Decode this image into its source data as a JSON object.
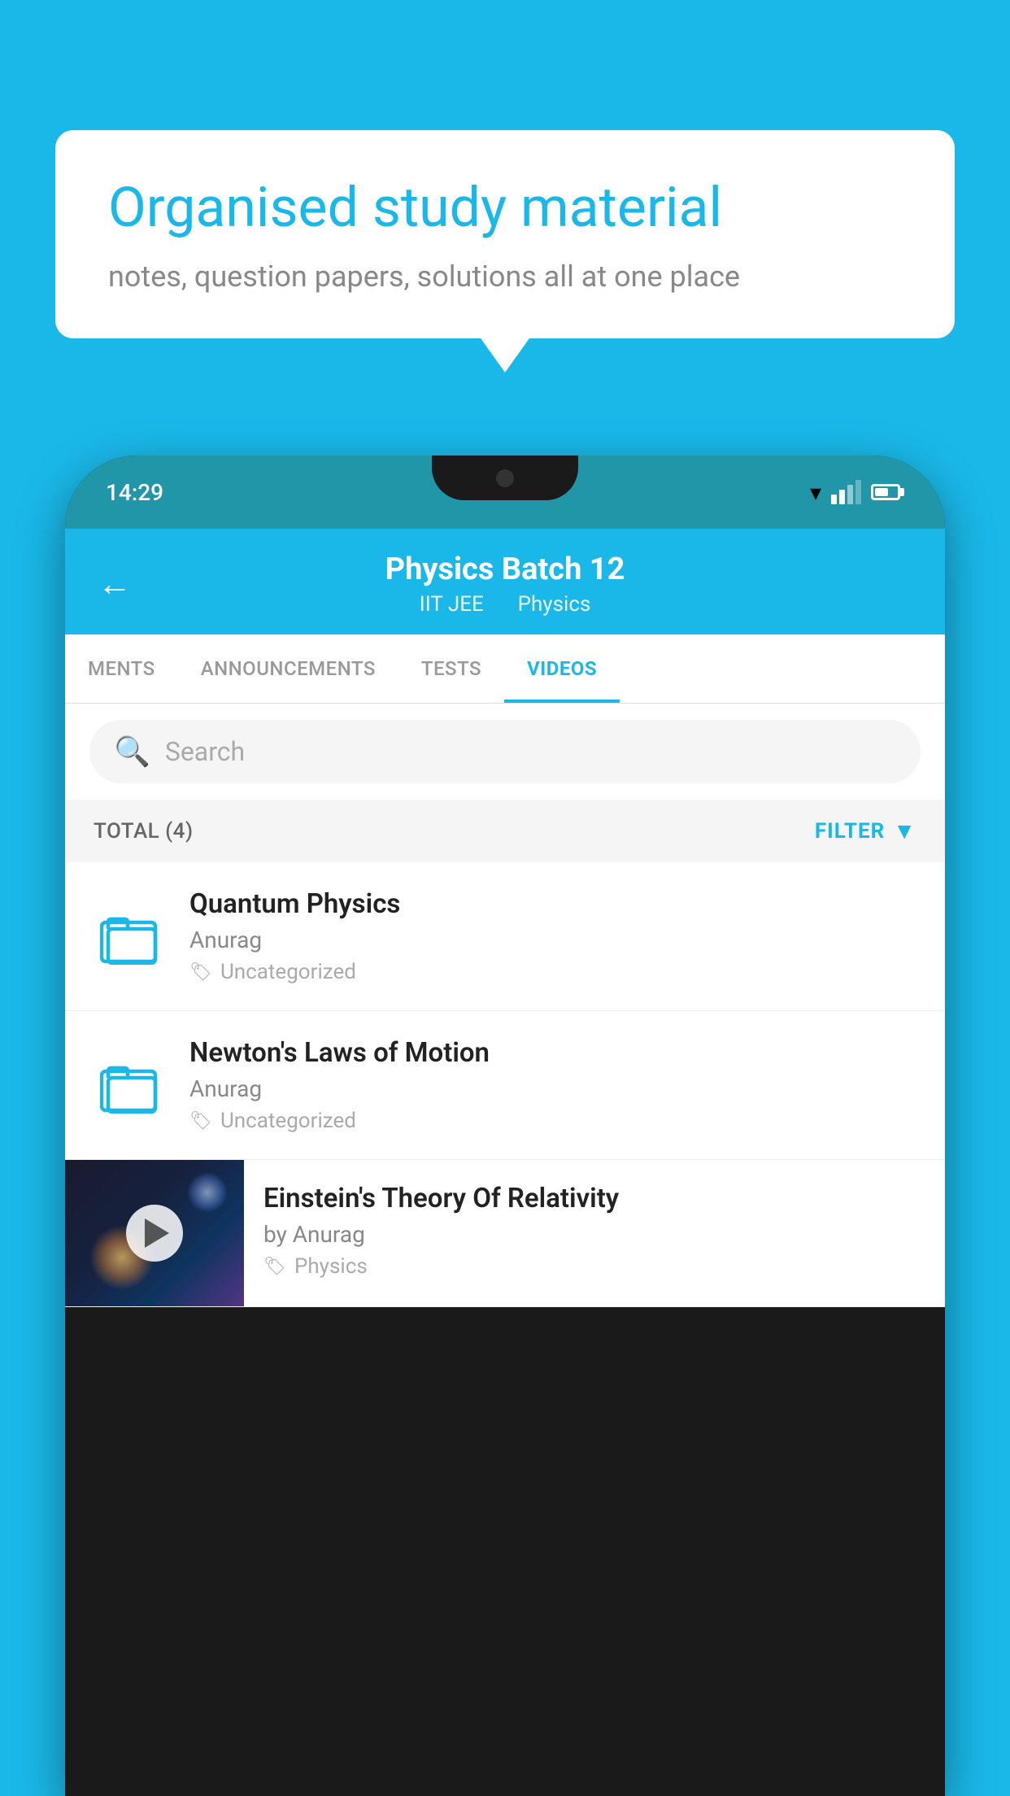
{
  "background_color": "#1ab8e8",
  "bubble": {
    "title": "Organised study material",
    "subtitle": "notes, question papers, solutions all at one place"
  },
  "status_bar": {
    "time": "14:29"
  },
  "app_header": {
    "title": "Physics Batch 12",
    "tag1": "IIT JEE",
    "tag2": "Physics",
    "back_label": "←"
  },
  "tabs": [
    {
      "label": "MENTS",
      "active": false
    },
    {
      "label": "ANNOUNCEMENTS",
      "active": false
    },
    {
      "label": "TESTS",
      "active": false
    },
    {
      "label": "VIDEOS",
      "active": true
    }
  ],
  "search": {
    "placeholder": "Search"
  },
  "filter": {
    "total_label": "TOTAL (4)",
    "filter_label": "FILTER"
  },
  "videos": [
    {
      "title": "Quantum Physics",
      "author": "Anurag",
      "tag": "Uncategorized",
      "type": "folder"
    },
    {
      "title": "Newton's Laws of Motion",
      "author": "Anurag",
      "tag": "Uncategorized",
      "type": "folder"
    },
    {
      "title": "Einstein's Theory Of Relativity",
      "author": "by Anurag",
      "tag": "Physics",
      "type": "thumbnail"
    }
  ]
}
